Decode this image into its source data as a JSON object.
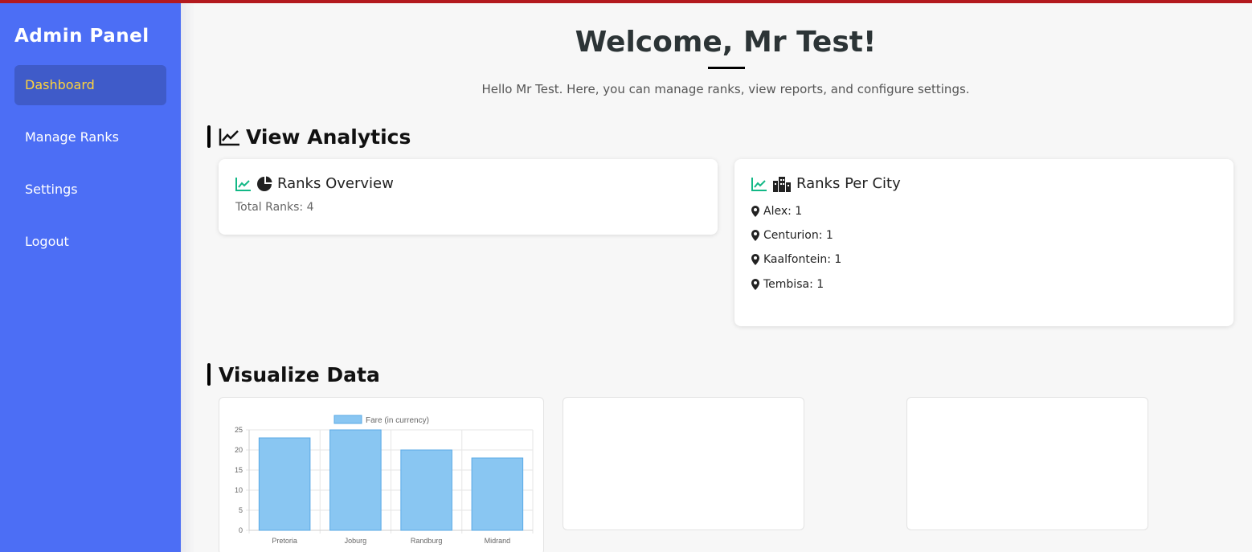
{
  "sidebar": {
    "title": "Admin Panel",
    "items": [
      {
        "label": "Dashboard"
      },
      {
        "label": "Manage Ranks"
      },
      {
        "label": "Settings"
      },
      {
        "label": "Logout"
      }
    ]
  },
  "header": {
    "welcome": "Welcome, Mr Test!",
    "subtitle": "Hello Mr Test. Here, you can manage ranks, view reports, and configure settings."
  },
  "analytics": {
    "title": "View Analytics",
    "ranks_overview": {
      "title": "Ranks Overview",
      "total": "Total Ranks: 4"
    },
    "ranks_per_city": {
      "title": "Ranks Per City",
      "cities": [
        "Alex: 1",
        "Centurion: 1",
        "Kaalfontein: 1",
        "Tembisa: 1"
      ]
    }
  },
  "visualize": {
    "title": "Visualize Data"
  },
  "colors": {
    "sidebar": "#4c6ef5",
    "active_item_text": "#ffd43b",
    "icon_green": "#12b886",
    "bar_fill": "#89c6f2",
    "top_accent": "#b3191e"
  },
  "icons": [
    "chart-line-icon",
    "pie-chart-icon",
    "city-icon",
    "map-marker-icon"
  ],
  "chart_data": {
    "type": "bar",
    "categories": [
      "Pretoria",
      "Joburg",
      "Randburg",
      "Midrand"
    ],
    "series": [
      {
        "name": "Fare (in currency)",
        "values": [
          23,
          25,
          20,
          18
        ]
      }
    ],
    "yticks": [
      "0",
      "5",
      "10",
      "15",
      "20",
      "25"
    ],
    "ylim": [
      0,
      25
    ],
    "grid": true,
    "legend": "top"
  }
}
